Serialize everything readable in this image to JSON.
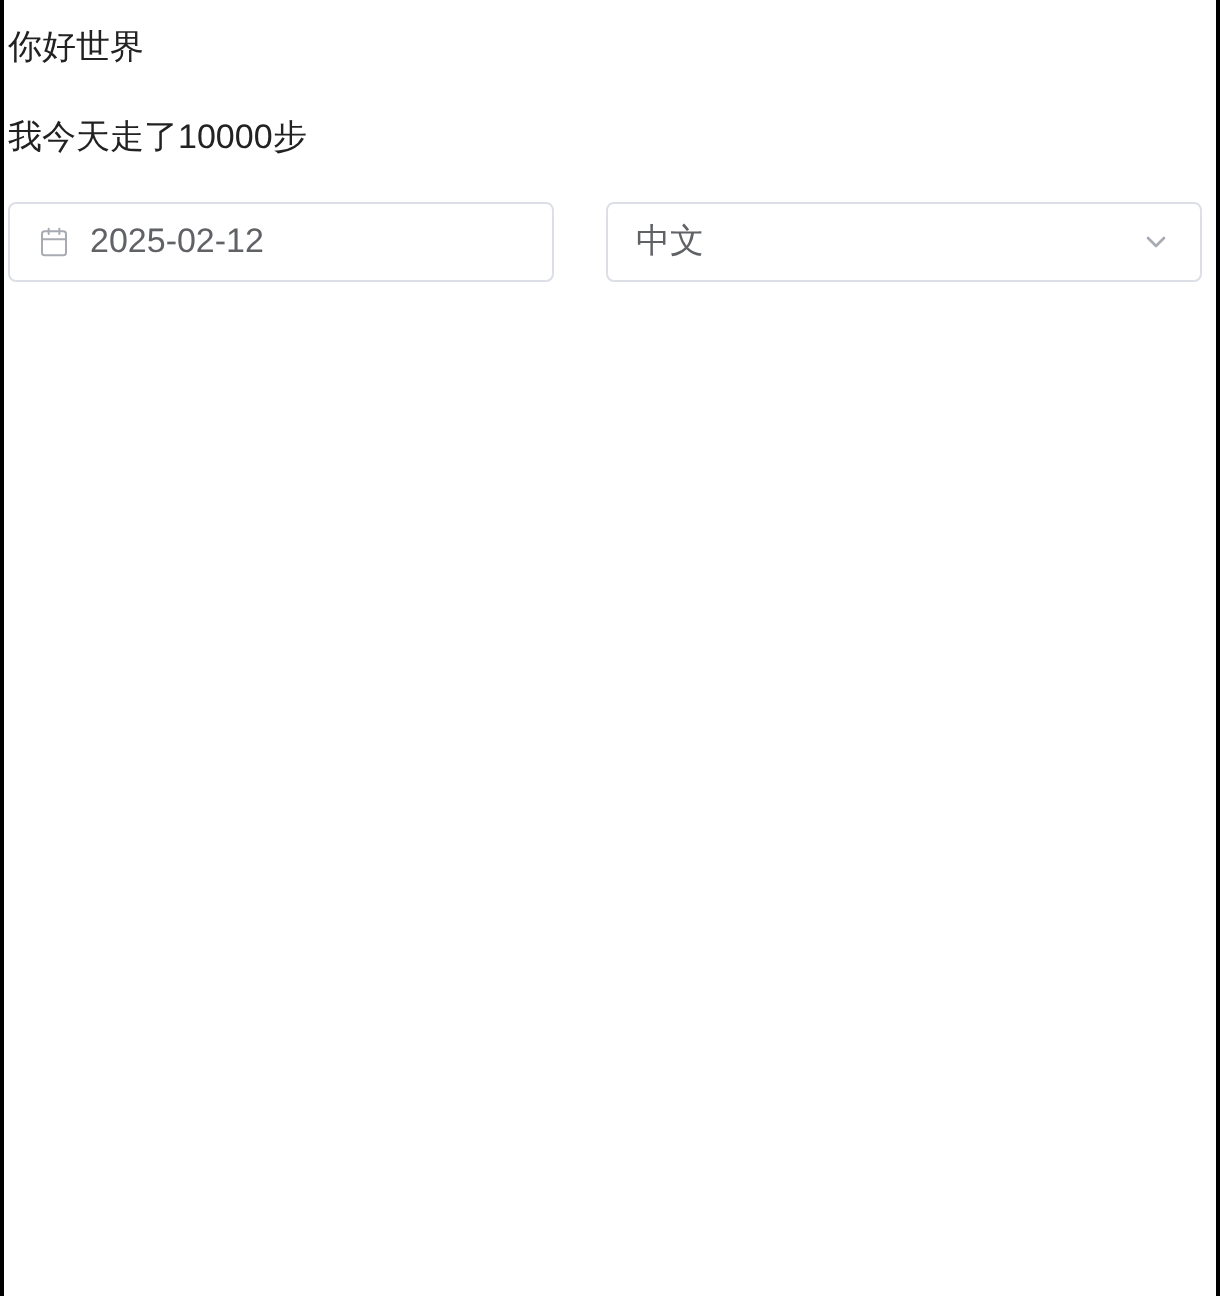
{
  "greeting": "你好世界",
  "steps_text": "我今天走了10000步",
  "date_picker": {
    "value": "2025-02-12"
  },
  "language_select": {
    "value": "中文"
  }
}
